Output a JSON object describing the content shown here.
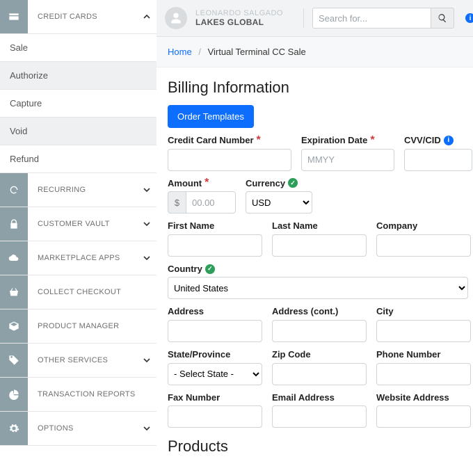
{
  "header": {
    "user_name": "LEONARDO SALGADO",
    "org": "LAKES GLOBAL",
    "search_placeholder": "Search for..."
  },
  "crumbs": {
    "home": "Home",
    "current": "Virtual Terminal CC Sale"
  },
  "sidebar": {
    "top": {
      "label": "CREDIT CARDS"
    },
    "subs": [
      {
        "label": "Sale"
      },
      {
        "label": "Authorize"
      },
      {
        "label": "Capture"
      },
      {
        "label": "Void"
      },
      {
        "label": "Refund"
      }
    ],
    "items": [
      {
        "label": "RECURRING"
      },
      {
        "label": "CUSTOMER VAULT"
      },
      {
        "label": "MARKETPLACE APPS"
      },
      {
        "label": "COLLECT CHECKOUT"
      },
      {
        "label": "PRODUCT MANAGER"
      },
      {
        "label": "OTHER SERVICES"
      },
      {
        "label": "TRANSACTION REPORTS"
      },
      {
        "label": "OPTIONS"
      }
    ]
  },
  "billing": {
    "heading": "Billing Information",
    "order_templates": "Order Templates",
    "labels": {
      "cc": "Credit Card Number",
      "exp": "Expiration Date",
      "cvv": "CVV/CID",
      "amount": "Amount",
      "currency": "Currency",
      "first": "First Name",
      "last": "Last Name",
      "company": "Company",
      "country": "Country",
      "addr": "Address",
      "addr2": "Address (cont.)",
      "city": "City",
      "state": "State/Province",
      "zip": "Zip Code",
      "phone": "Phone Number",
      "fax": "Fax Number",
      "email": "Email Address",
      "website": "Website Address"
    },
    "placeholders": {
      "exp": "MMYY",
      "amount": "00.00"
    },
    "currency_sym": "$",
    "currency_options": [
      "USD"
    ],
    "country_options": [
      "United States"
    ],
    "state_placeholder": "- Select State -"
  },
  "products": {
    "heading": "Products"
  }
}
